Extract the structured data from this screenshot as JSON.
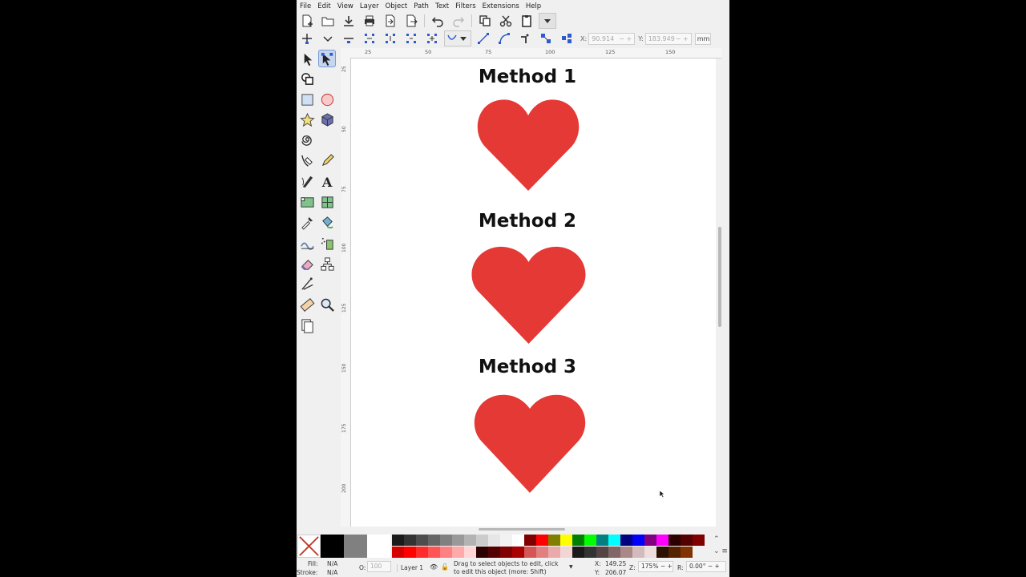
{
  "menu": [
    "File",
    "Edit",
    "View",
    "Layer",
    "Object",
    "Path",
    "Text",
    "Filters",
    "Extensions",
    "Help"
  ],
  "coords": {
    "x_label": "X:",
    "x_value": "90.914",
    "y_label": "Y:",
    "y_value": "183.949",
    "unit": "mm"
  },
  "ruler": {
    "h_labels": [
      "25",
      "50",
      "75",
      "100",
      "125",
      "150"
    ],
    "v_labels": [
      "25",
      "50",
      "75",
      "100",
      "125",
      "150",
      "175",
      "200"
    ]
  },
  "canvas": {
    "methods": [
      {
        "title": "Method 1"
      },
      {
        "title": "Method 2"
      },
      {
        "title": "Method 3"
      }
    ],
    "heart_color": "#e53935"
  },
  "palette": {
    "row1": [
      "#1a1a1a",
      "#333333",
      "#4d4d4d",
      "#666666",
      "#808080",
      "#999999",
      "#b3b3b3",
      "#cccccc",
      "#e6e6e6",
      "#f2f2f2",
      "#ffffff",
      "#800000",
      "#ff0000",
      "#808000",
      "#ffff00",
      "#008000",
      "#00ff00",
      "#008080",
      "#00ffff",
      "#000080",
      "#0000ff",
      "#800080",
      "#ff00ff",
      "#2b0000",
      "#550000",
      "#800000"
    ],
    "row2": [
      "#d40000",
      "#ff0000",
      "#ff2a2a",
      "#ff5555",
      "#ff8080",
      "#ffaaaa",
      "#ffd5d5",
      "#2b0000",
      "#550000",
      "#800000",
      "#aa0000",
      "#d45555",
      "#e08080",
      "#eaaaaa",
      "#f4d5d5",
      "#1a1a1a",
      "#333333",
      "#554444",
      "#806666",
      "#aa8888",
      "#d4bbbb",
      "#eedddd",
      "#2b1100",
      "#552200",
      "#803300"
    ]
  },
  "status": {
    "fill_label": "Fill:",
    "fill_value": "N/A",
    "stroke_label": "Stroke:",
    "stroke_value": "N/A",
    "opacity_label": "O:",
    "opacity_value": "100",
    "layer": "Layer 1",
    "message": "Drag to select objects to edit, click to edit this object (more: Shift)",
    "cx_label": "X:",
    "cx_value": "149.25",
    "cy_label": "Y:",
    "cy_value": "206.07",
    "zoom_label": "Z:",
    "zoom_value": "175%",
    "rot_label": "R:",
    "rot_value": "0.00°"
  }
}
